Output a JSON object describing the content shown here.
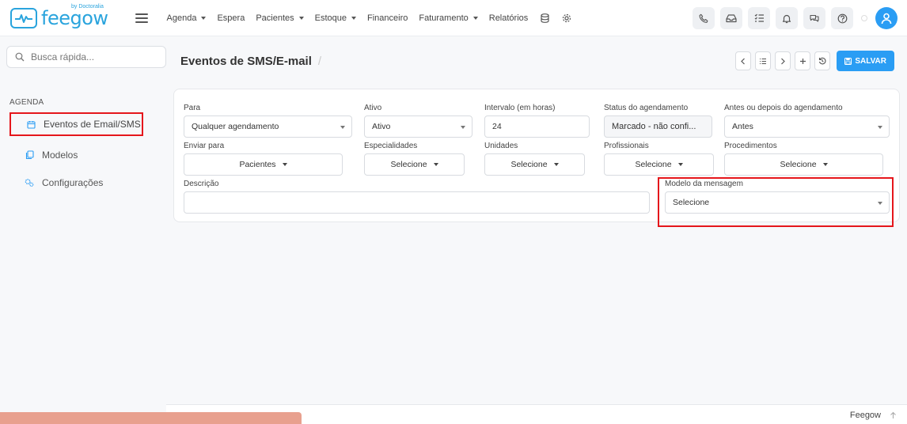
{
  "brand": {
    "name": "feegow",
    "byline": "by Doctoralia",
    "color": "#2aa4dd"
  },
  "nav": {
    "items": [
      {
        "label": "Agenda",
        "dropdown": true
      },
      {
        "label": "Espera",
        "dropdown": false
      },
      {
        "label": "Pacientes",
        "dropdown": true
      },
      {
        "label": "Estoque",
        "dropdown": true
      },
      {
        "label": "Financeiro",
        "dropdown": false
      },
      {
        "label": "Faturamento",
        "dropdown": true
      },
      {
        "label": "Relatórios",
        "dropdown": false
      }
    ],
    "extra_icons": [
      "database-icon",
      "settings-gear-icon"
    ],
    "right_icons": [
      "phone-icon",
      "inbox-icon",
      "tasks-list-icon",
      "bell-icon",
      "chat-icon",
      "help-icon"
    ]
  },
  "sidebar": {
    "search_placeholder": "Busca rápida...",
    "section": "AGENDA",
    "items": [
      {
        "label": "Eventos de Email/SMS",
        "icon": "calendar-icon",
        "active": true
      },
      {
        "label": "Modelos",
        "icon": "copy-icon",
        "active": false
      },
      {
        "label": "Configurações",
        "icon": "gears-icon",
        "active": false
      }
    ]
  },
  "page": {
    "title": "Eventos de SMS/E-mail",
    "breadcrumb_sep": "/",
    "save_label": "SALVAR",
    "accent": "#2a9df4"
  },
  "form": {
    "para": {
      "label": "Para",
      "value": "Qualquer agendamento"
    },
    "ativo": {
      "label": "Ativo",
      "value": "Ativo"
    },
    "intervalo": {
      "label": "Intervalo (em horas)",
      "value": "24"
    },
    "status": {
      "label": "Status do agendamento",
      "value": "Marcado - não confi..."
    },
    "antes": {
      "label": "Antes ou depois do agendamento",
      "value": "Antes"
    },
    "enviar": {
      "label": "Enviar para",
      "value": "Pacientes"
    },
    "especialidades": {
      "label": "Especialidades",
      "value": "Selecione"
    },
    "unidades": {
      "label": "Unidades",
      "value": "Selecione"
    },
    "profissionais": {
      "label": "Profissionais",
      "value": "Selecione"
    },
    "procedimentos": {
      "label": "Procedimentos",
      "value": "Selecione"
    },
    "descricao": {
      "label": "Descrição",
      "value": ""
    },
    "modelo": {
      "label": "Modelo da mensagem",
      "value": "Selecione"
    }
  },
  "footer": {
    "brand": "Feegow"
  },
  "highlight_color": "#e5161b"
}
